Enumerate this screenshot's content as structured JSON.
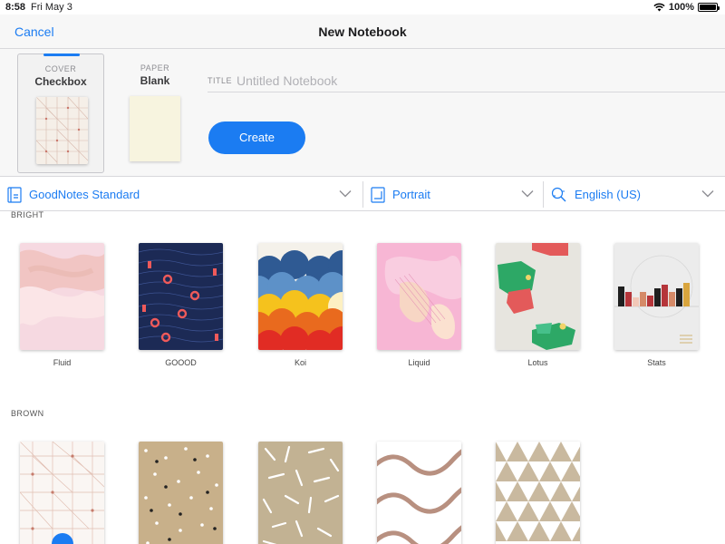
{
  "status": {
    "time": "8:58",
    "date": "Fri May 3",
    "battery": "100%"
  },
  "nav": {
    "cancel": "Cancel",
    "title": "New Notebook"
  },
  "cover_selector": {
    "label": "COVER",
    "value": "Checkbox"
  },
  "paper_selector": {
    "label": "PAPER",
    "value": "Blank"
  },
  "title_field": {
    "label": "TITLE",
    "value": "",
    "placeholder": "Untitled Notebook"
  },
  "create_button": "Create",
  "filters": {
    "collection": "GoodNotes Standard",
    "orientation": "Portrait",
    "language": "English (US)"
  },
  "sections": [
    {
      "title": "BRIGHT",
      "covers": [
        "Fluid",
        "GOOOD",
        "Koi",
        "Liquid",
        "Lotus",
        "Stats"
      ]
    },
    {
      "title": "BROWN",
      "covers": []
    }
  ],
  "colors": {
    "accent": "#1b7cf2"
  }
}
